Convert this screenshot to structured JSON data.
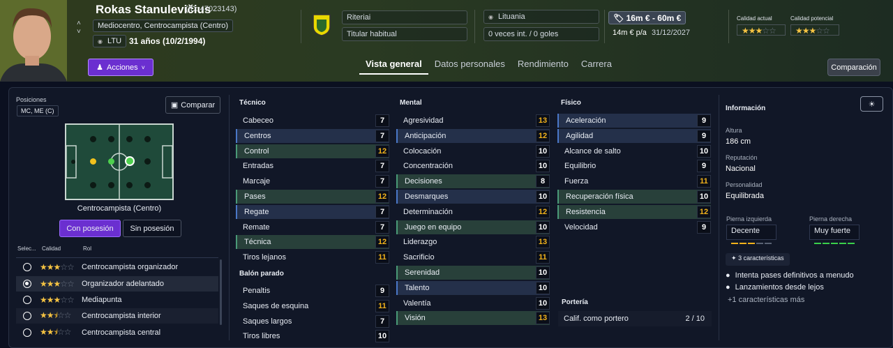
{
  "header": {
    "name": "Rokas Stanulevičius",
    "id": "(ID: 47023143)",
    "position": "Mediocentro, Centrocampista (Centro)",
    "nation_code": "LTU",
    "age": "31 años (10/2/1994)",
    "actions_label": "Acciones",
    "club": "Riteriai",
    "squad_status": "Titular habitual",
    "nation": "Lituania",
    "caps": "0 veces int. / 0 goles",
    "value": "16m € - 60m €",
    "wage": "14m € p/a",
    "contract": "31/12/2027",
    "current_ability_label": "Calidad actual",
    "potential_ability_label": "Calidad potencial",
    "current_ability_stars": 3,
    "potential_ability_stars": 3,
    "compare_label": "Comparación"
  },
  "tabs": [
    "Vista general",
    "Datos personales",
    "Rendimiento",
    "Carrera"
  ],
  "positions": {
    "title": "Posiciones",
    "value": "MC, ME (C)",
    "compare_label": "Comparar",
    "role_name": "Centrocampista (Centro)",
    "with_ball": "Con posesión",
    "without_ball": "Sin posesión",
    "headers": [
      "Selec...",
      "Calidad",
      "Rol"
    ],
    "roles": [
      {
        "name": "Centrocampista organizador",
        "stars": 3,
        "selected": false
      },
      {
        "name": "Organizador adelantado",
        "stars": 3,
        "selected": true
      },
      {
        "name": "Mediapunta",
        "stars": 3,
        "selected": false
      },
      {
        "name": "Centrocampista interior",
        "stars": 2.5,
        "selected": false
      },
      {
        "name": "Centrocampista central",
        "stars": 2.5,
        "selected": false
      }
    ]
  },
  "tecnico": {
    "title": "Técnico",
    "attrs": [
      {
        "name": "Cabeceo",
        "value": "7",
        "hl": ""
      },
      {
        "name": "Centros",
        "value": "7",
        "hl": "hb"
      },
      {
        "name": "Control",
        "value": "12",
        "hl": "hg"
      },
      {
        "name": "Entradas",
        "value": "7",
        "hl": ""
      },
      {
        "name": "Marcaje",
        "value": "7",
        "hl": ""
      },
      {
        "name": "Pases",
        "value": "12",
        "hl": "hg"
      },
      {
        "name": "Regate",
        "value": "7",
        "hl": "hb"
      },
      {
        "name": "Remate",
        "value": "7",
        "hl": ""
      },
      {
        "name": "Técnica",
        "value": "12",
        "hl": "hg"
      },
      {
        "name": "Tiros lejanos",
        "value": "11",
        "hl": ""
      }
    ]
  },
  "balon_parado": {
    "title": "Balón parado",
    "attrs": [
      {
        "name": "Penaltis",
        "value": "9",
        "hl": ""
      },
      {
        "name": "Saques de esquina",
        "value": "11",
        "hl": ""
      },
      {
        "name": "Saques largos",
        "value": "7",
        "hl": ""
      },
      {
        "name": "Tiros libres",
        "value": "10",
        "hl": ""
      }
    ]
  },
  "mental": {
    "title": "Mental",
    "attrs": [
      {
        "name": "Agresividad",
        "value": "13",
        "hl": ""
      },
      {
        "name": "Anticipación",
        "value": "12",
        "hl": "hb"
      },
      {
        "name": "Colocación",
        "value": "10",
        "hl": ""
      },
      {
        "name": "Concentración",
        "value": "10",
        "hl": ""
      },
      {
        "name": "Decisiones",
        "value": "8",
        "hl": "hg"
      },
      {
        "name": "Desmarques",
        "value": "10",
        "hl": "hb"
      },
      {
        "name": "Determinación",
        "value": "12",
        "hl": ""
      },
      {
        "name": "Juego en equipo",
        "value": "10",
        "hl": "hg"
      },
      {
        "name": "Liderazgo",
        "value": "13",
        "hl": ""
      },
      {
        "name": "Sacrificio",
        "value": "11",
        "hl": ""
      },
      {
        "name": "Serenidad",
        "value": "10",
        "hl": "hg"
      },
      {
        "name": "Talento",
        "value": "10",
        "hl": "hb"
      },
      {
        "name": "Valentía",
        "value": "10",
        "hl": ""
      },
      {
        "name": "Visión",
        "value": "13",
        "hl": "hg"
      }
    ]
  },
  "fisico": {
    "title": "Físico",
    "attrs": [
      {
        "name": "Aceleración",
        "value": "9",
        "hl": "hb"
      },
      {
        "name": "Agilidad",
        "value": "9",
        "hl": "hb"
      },
      {
        "name": "Alcance de salto",
        "value": "10",
        "hl": ""
      },
      {
        "name": "Equilibrio",
        "value": "9",
        "hl": ""
      },
      {
        "name": "Fuerza",
        "value": "11",
        "hl": ""
      },
      {
        "name": "Recuperación física",
        "value": "10",
        "hl": "hg"
      },
      {
        "name": "Resistencia",
        "value": "12",
        "hl": "hg"
      },
      {
        "name": "Velocidad",
        "value": "9",
        "hl": ""
      }
    ]
  },
  "porteria": {
    "title": "Portería",
    "label": "Calif. como portero",
    "value": "2 / 10"
  },
  "info": {
    "title": "Información",
    "height_label": "Altura",
    "height": "186 cm",
    "rep_label": "Reputación",
    "rep": "Nacional",
    "pers_label": "Personalidad",
    "pers": "Equilibrada",
    "left_label": "Pierna izquierda",
    "left": "Decente",
    "right_label": "Pierna derecha",
    "right": "Muy fuerte",
    "traits_count": "3 características",
    "traits": [
      "Intenta pases definitivos a menudo",
      "Lanzamientos desde lejos"
    ],
    "more": "+1 características más"
  }
}
